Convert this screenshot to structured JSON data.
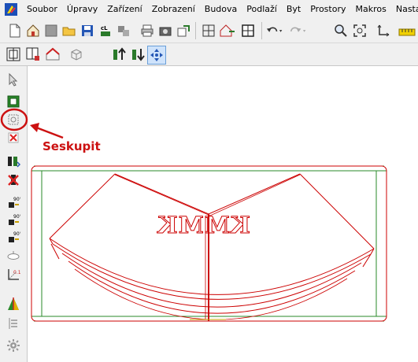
{
  "menu": {
    "items": [
      {
        "label": "Soubor"
      },
      {
        "label": "Úpravy"
      },
      {
        "label": "Zařízení"
      },
      {
        "label": "Zobrazení"
      },
      {
        "label": "Budova"
      },
      {
        "label": "Podlaží"
      },
      {
        "label": "Byt"
      },
      {
        "label": "Prostory"
      },
      {
        "label": "Makros"
      },
      {
        "label": "Nasta"
      }
    ]
  },
  "toolbar_main": {
    "icons": [
      "new-file-icon",
      "open-house-icon",
      "blank-page-icon",
      "open-folder-icon",
      "save-icon",
      "cl-report-icon",
      "copy-blocks-icon",
      "print-icon",
      "camera-icon",
      "export-icon",
      "room-grid-icon",
      "house-walls-icon",
      "window-grid-icon",
      "undo-icon",
      "redo-icon",
      "zoom-icon",
      "zoom-fit-icon",
      "axes-icon",
      "ruler-icon"
    ]
  },
  "toolbar_secondary": {
    "icons": [
      "select-frame-icon",
      "room-select-icon",
      "house-icon",
      "cube-icon",
      "floor-up-icon",
      "floor-down-icon",
      "move-arrows-icon"
    ]
  },
  "left_toolbar": {
    "icons": [
      "pointer-arrow-icon",
      "frame-select-icon",
      "group-icon",
      "delete-object-icon",
      "people-icon",
      "delete-person-icon",
      "rotate-90-icon",
      "rotate-90-b-icon",
      "rotate-90-c-icon",
      "ellipse-icon",
      "axis-measure-icon",
      "pyramid-icon",
      "list-icon",
      "gear-icon"
    ]
  },
  "annotation": {
    "label": "Seskupit",
    "color": "#cc1111"
  },
  "drawing": {
    "text": "KMMK",
    "line_color": "#cc0000",
    "frame_color": "#2a8a2a"
  }
}
